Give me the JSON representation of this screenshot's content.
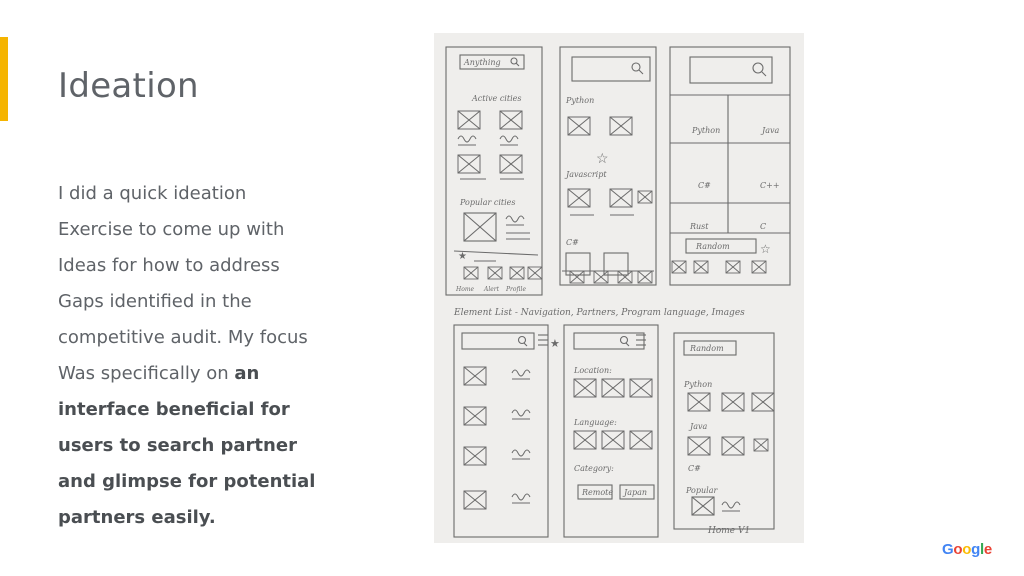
{
  "slide": {
    "title": "Ideation",
    "body_lines": [
      "I did a quick ideation",
      "Exercise to come up with",
      "Ideas for how to address",
      "Gaps identified in the",
      "competitive audit. My focus"
    ],
    "body_last_prefix": "Was specifically on ",
    "body_bold_lines": [
      "an",
      "interface beneficial for",
      "users to search partner",
      "and glimpse for potential",
      "partners easily."
    ]
  },
  "sketch": {
    "caption": "Element List - Navigation, Partners, Program language, Images",
    "frame1": {
      "search": "Anything",
      "section_active": "Active cities",
      "section_popular": "Popular cities",
      "nav": [
        "Home",
        "Alert",
        "Profile"
      ]
    },
    "frame2": {
      "labels": [
        "Python",
        "Javascript",
        "C#"
      ]
    },
    "frame3": {
      "cells": [
        "Python",
        "Java",
        "C#",
        "C++",
        "Rust",
        "C"
      ],
      "random": "Random"
    },
    "frame5": {
      "labels": [
        "Location:",
        "Language:",
        "Category:"
      ],
      "chips": [
        "Remote",
        "Japan"
      ]
    },
    "frame6": {
      "random": "Random",
      "labels": [
        "Python",
        "Java",
        "C#",
        "Popular"
      ],
      "note": "Home V1"
    }
  },
  "colors": {
    "accent": "#f5b400",
    "text": "#5f6368",
    "pencil": "#6b6b6b"
  },
  "logo": {
    "letters": [
      "G",
      "o",
      "o",
      "g",
      "l",
      "e"
    ],
    "colors": [
      "#4285f4",
      "#ea4335",
      "#fbbc05",
      "#4285f4",
      "#34a853",
      "#ea4335"
    ]
  }
}
